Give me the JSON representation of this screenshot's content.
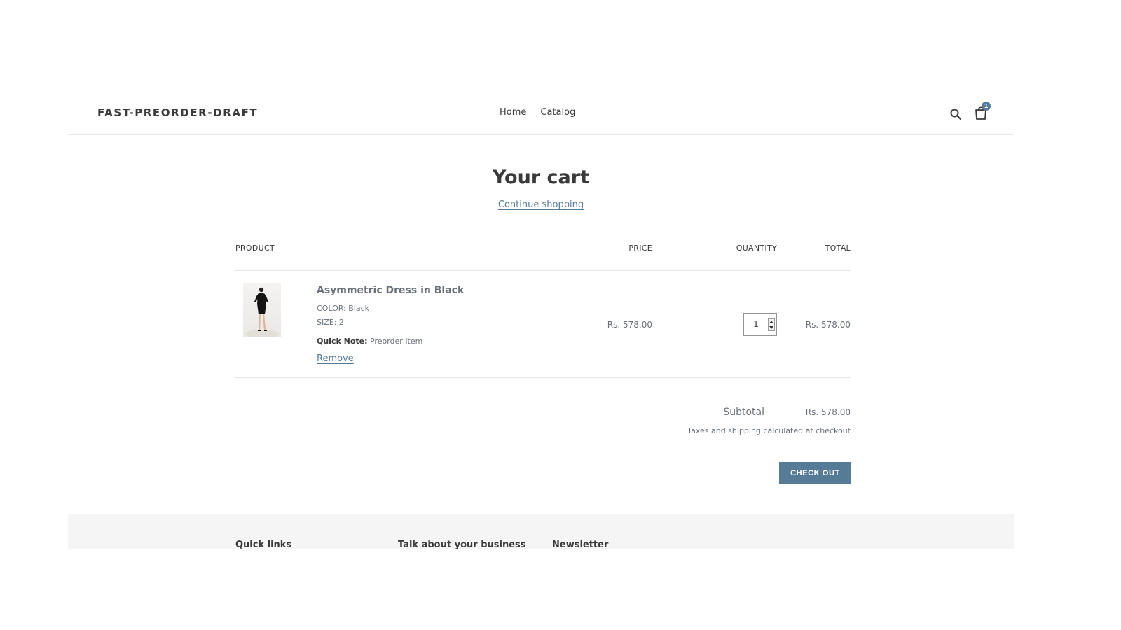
{
  "header": {
    "logo": "FAST-PREORDER-DRAFT",
    "nav": [
      "Home",
      "Catalog"
    ],
    "cart_count": "1",
    "icons": [
      "search-icon",
      "cart-icon"
    ]
  },
  "cart": {
    "title": "Your cart",
    "continue_label": "Continue shopping",
    "columns": {
      "product": "PRODUCT",
      "price": "PRICE",
      "quantity": "QUANTITY",
      "total": "TOTAL"
    },
    "items": [
      {
        "name": "Asymmetric Dress in Black",
        "options": [
          "COLOR: Black",
          "SIZE: 2"
        ],
        "note_label": "Quick Note:",
        "note_value": " Preorder Item",
        "remove_label": "Remove",
        "price": "Rs. 578.00",
        "quantity": "1",
        "total": "Rs. 578.00"
      }
    ],
    "subtotal_label": "Subtotal",
    "subtotal_value": "Rs. 578.00",
    "taxes_note": "Taxes and shipping calculated at checkout",
    "checkout_label": "CHECK OUT"
  },
  "footer": {
    "headings": [
      "Quick links",
      "Talk about your business",
      "Newsletter"
    ]
  },
  "colors": {
    "accent": "#557b97",
    "text": "#3a3a3a",
    "muted": "#69727b",
    "footer_bg": "#f5f5f5"
  }
}
